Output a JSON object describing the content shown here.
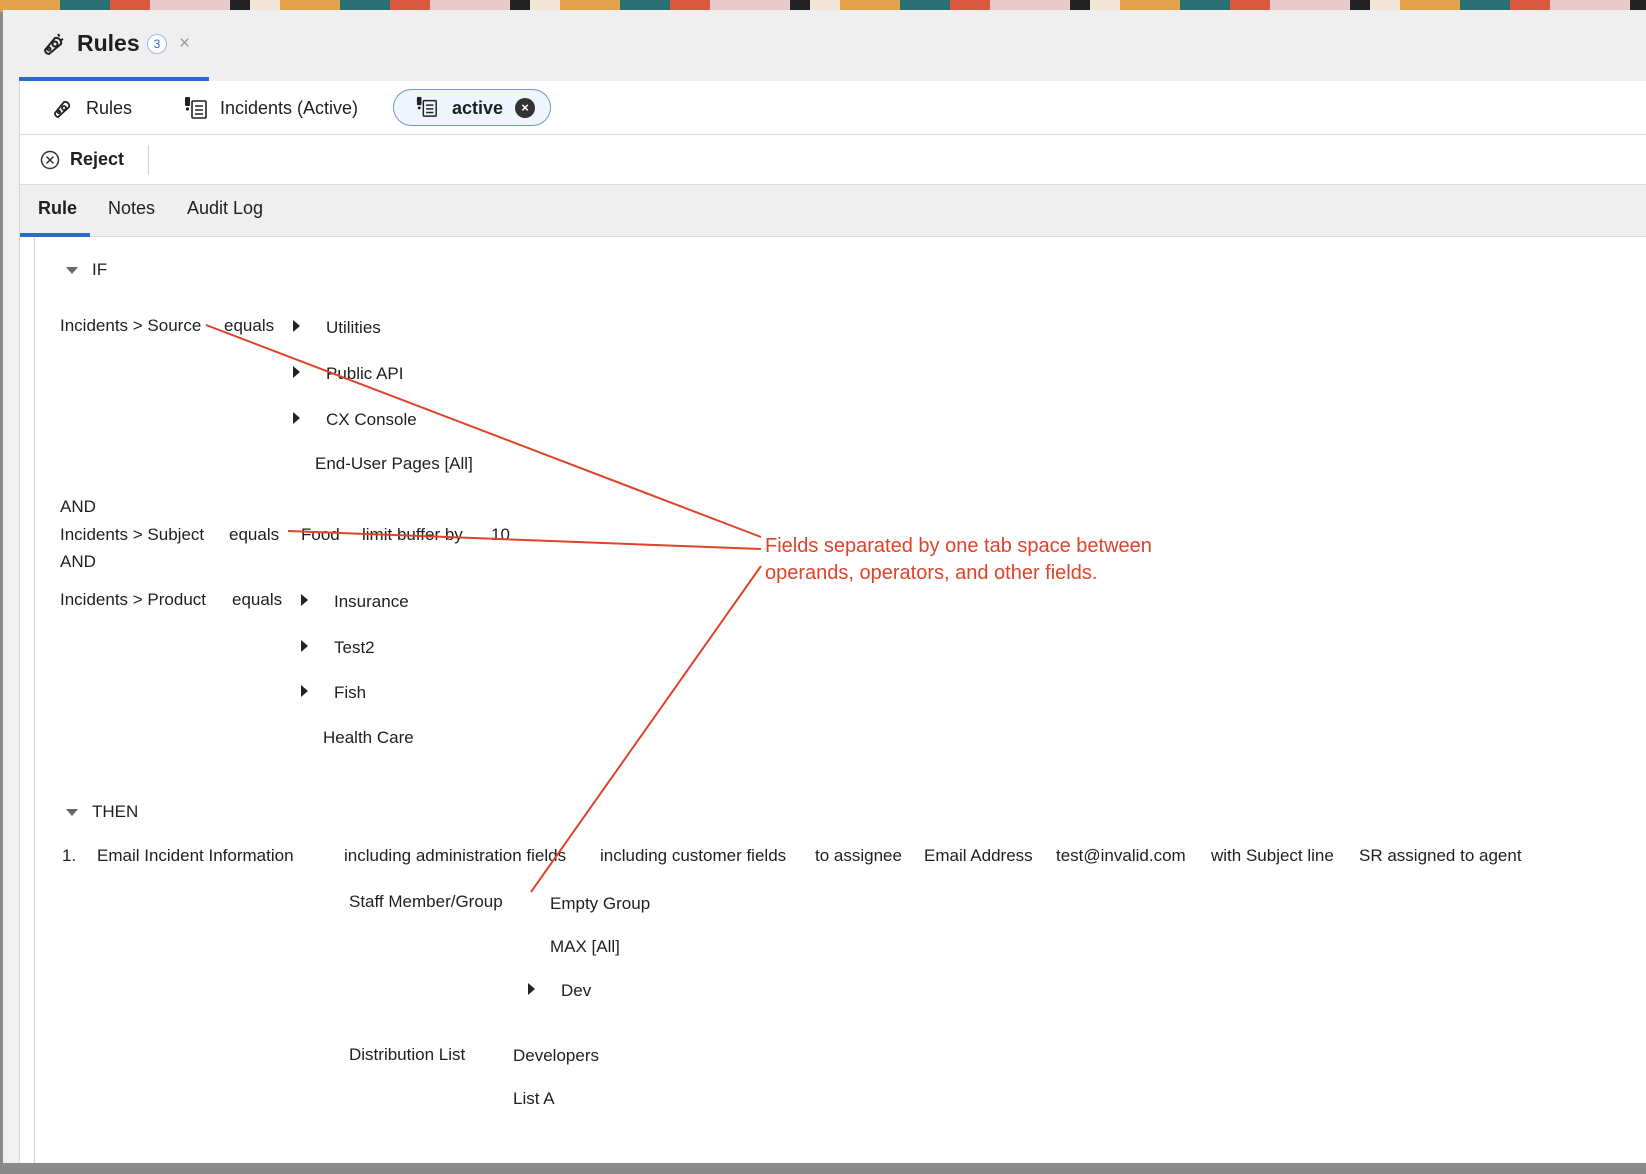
{
  "window": {
    "title": "Rules",
    "badge_count": "3",
    "close_glyph": "×"
  },
  "breadcrumbs": {
    "rules_label": "Rules",
    "incidents_label": "Incidents (Active)",
    "active_pill_label": "active",
    "active_pill_close": "×"
  },
  "toolbar": {
    "reject_label": "Reject"
  },
  "tabs": [
    "Rule",
    "Notes",
    "Audit Log"
  ],
  "rule": {
    "if_label": "IF",
    "then_label": "THEN",
    "and_label": "AND",
    "condition1": {
      "field": "Incidents > Source",
      "operator": "equals",
      "values": [
        "Utilities",
        "Public API",
        "CX Console",
        "End-User Pages [All]"
      ]
    },
    "condition2": {
      "field": "Incidents > Subject",
      "operator": "equals",
      "value": "Food",
      "modifier": "limit buffer by",
      "modifier_value": "10"
    },
    "condition3": {
      "field": "Incidents > Product",
      "operator": "equals",
      "values": [
        "Insurance",
        "Test2",
        "Fish",
        "Health Care"
      ]
    },
    "action1": {
      "number": "1.",
      "name": "Email Incident Information",
      "parts": [
        "including administration fields",
        "including customer fields",
        "to assignee",
        "Email Address",
        "test@invalid.com",
        "with Subject line",
        "SR assigned to agent"
      ],
      "staff_label": "Staff Member/Group",
      "staff_values": [
        "Empty Group",
        "MAX [All]",
        "Dev"
      ],
      "distribution_label": "Distribution List",
      "distribution_values": [
        "Developers",
        "List A"
      ]
    }
  },
  "annotation": {
    "line1": "Fields separated by one tab space between",
    "line2": "operands, operators, and other fields.",
    "color": "#e0422a"
  },
  "colors": {
    "accent": "#2a6dc8",
    "annotation": "#e0422a"
  },
  "icons": {
    "rules": "puzzle-gear-icon",
    "incidents": "incident-list-icon",
    "reject": "circle-x-icon"
  }
}
